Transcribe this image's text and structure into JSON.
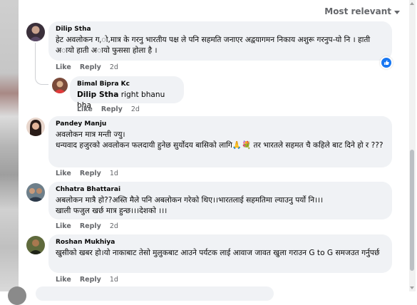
{
  "sort": {
    "label": "Most relevant",
    "icon": "caret-down-icon"
  },
  "comments": [
    {
      "author": "Dilip Stha",
      "text": "हेट अवलोकन ग,ो,मात्र के गरनु भारतीय पक्ष ले पनि सहमति जनाएर अद्वयागमन निकाय अशुरू गरनुप-यो नि । हाती अायो हाती अायो फुससा होला है ।",
      "like": "Like",
      "reply": "Reply",
      "time": "2d",
      "reaction": "like-icon"
    },
    {
      "author": "Bimal Bipra Kc",
      "mention": "Dilip Stha",
      "text": " right bhanu bha",
      "like": "Like",
      "reply": "Reply",
      "time": "2d"
    },
    {
      "author": "Pandey Manju",
      "text": "अवलोकन मात्र मन्ती ज्यु।\nधन्यवाद हजुरको अवलोकन फलदायी हुनेछ सुर्योदय बासिको लागि🙏💐 तर भारतले सहमत चै कहिले बाट दिने हो र ???",
      "like": "Like",
      "reply": "Reply",
      "time": "1d"
    },
    {
      "author": "Chhatra Bhattarai",
      "text": "अबलोकन मात्रै हो??अस्ति मैले पनि अबलोकन गरेको थिए।।भारतलाई सहमतिमा ल्याउनु पर्यो नि।।।\nखाली फजुल खर्छ मात्र हुन्छ।।।देशको ।।।",
      "like": "Like",
      "reply": "Reply",
      "time": "2d"
    },
    {
      "author": "Roshan Mukhiya",
      "text": "खुसीको खबर हो।यो नाकाबाट तेसो मुलुकबाट आउने पर्यटक लाई आवाज जावत खुला गराउन G to G समजउत गर्नुपर्छ",
      "like": "Like",
      "reply": "Reply",
      "time": "1d"
    }
  ]
}
